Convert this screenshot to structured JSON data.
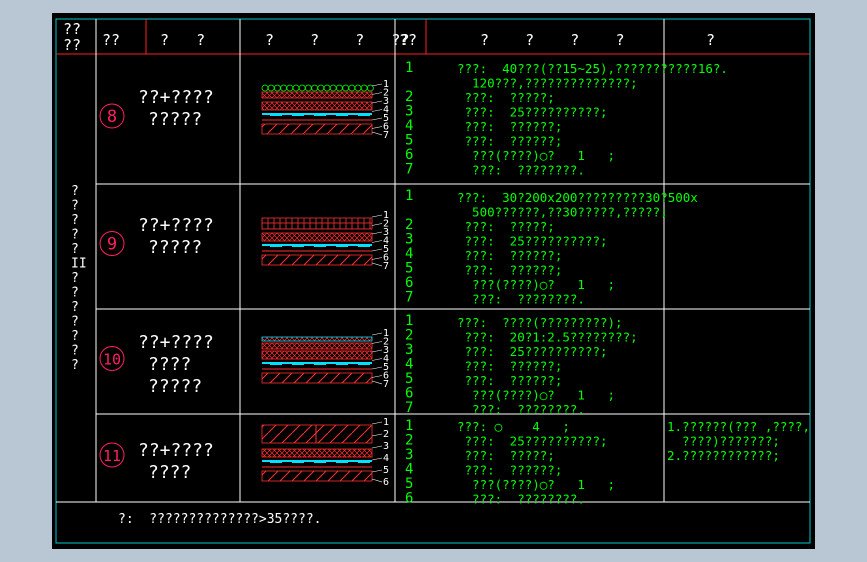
{
  "theme": {
    "background": "#b9c6d3",
    "canvas": "#000000",
    "border": "#00c8c8",
    "grid_lines": "#ff2020",
    "row_lines": "#ffffff",
    "text_white": "#ffffff",
    "text_green": "#00ff00",
    "circle_red": "#ff2060",
    "hatch": "#ff3030",
    "membrane": "#00e0ff",
    "gravel": "#00ff00"
  },
  "header": {
    "col0_line1": "??",
    "col0_line2": "??",
    "col1": "??",
    "col2": "?   ?",
    "col3": "?    ?    ?   ??",
    "col4": "??",
    "col5": "?    ?    ?    ?",
    "col6": "?           ?"
  },
  "category_label": [
    "?",
    "?",
    "?",
    "?",
    "?",
    "II",
    "?",
    "?",
    "?",
    "?",
    "?",
    "?",
    "?"
  ],
  "rows": [
    {
      "number": "8",
      "name_lines": [
        "??+????",
        "?????"
      ],
      "section_labels": [
        "1",
        "2",
        "3",
        "4",
        "5",
        "6",
        "7"
      ],
      "seq": [
        "1",
        "",
        "2",
        "3",
        "4",
        "5",
        "6",
        "7"
      ],
      "desc": [
        "???:  40???(??15~25),???????????16?.",
        "  120???,??????????????;",
        " ???:  ?????;",
        " ???:  25??????????;",
        " ???:  ??????;",
        " ???:  ??????;",
        "  ???(????)◯?   1   ;",
        "  ???:  ????????."
      ],
      "note": []
    },
    {
      "number": "9",
      "name_lines": [
        "??+????",
        "?????"
      ],
      "section_labels": [
        "1",
        "2",
        "3",
        "4",
        "5",
        "6",
        "7"
      ],
      "seq": [
        "1",
        "",
        "2",
        "3",
        "4",
        "5",
        "6",
        "7"
      ],
      "desc": [
        "???:  30?200x200?????????30?500x",
        "  500??????,??30?????,?????;",
        " ???:  ?????;",
        " ???:  25??????????;",
        " ???:  ??????;",
        " ???:  ??????;",
        "  ???(????)◯?   1   ;",
        "  ???:  ????????."
      ],
      "note": []
    },
    {
      "number": "10",
      "name_lines": [
        "??+????",
        "????",
        "?????"
      ],
      "section_labels": [
        "1",
        "2",
        "3",
        "4",
        "5",
        "6",
        "7"
      ],
      "seq": [
        "1",
        "2",
        "3",
        "4",
        "5",
        "6",
        "7"
      ],
      "desc": [
        "???:  ????(?????????);",
        " ???:  20?1:2.5????????;",
        " ???:  25??????????;",
        " ???:  ??????;",
        " ???:  ??????;",
        "  ???(????)◯?   1   ;",
        "  ???:  ????????."
      ],
      "note": []
    },
    {
      "number": "11",
      "name_lines": [
        "??+????",
        "????"
      ],
      "section_labels": [
        "1",
        "2",
        "3",
        "4",
        "5",
        "6"
      ],
      "seq": [
        "1",
        "2",
        "3",
        "4",
        "5",
        "6"
      ],
      "desc": [
        "???: ◯    4   ;",
        " ???:  25??????????;",
        " ???:  ?????;",
        " ???:  ??????;",
        "  ???(????)◯?   1   ;",
        "  ???:  ????????."
      ],
      "note": [
        "1.??????(??? ,????,",
        "  ????)???????;",
        "2.????????????;"
      ]
    }
  ],
  "footer_note": "?:  ??????????????>35????."
}
